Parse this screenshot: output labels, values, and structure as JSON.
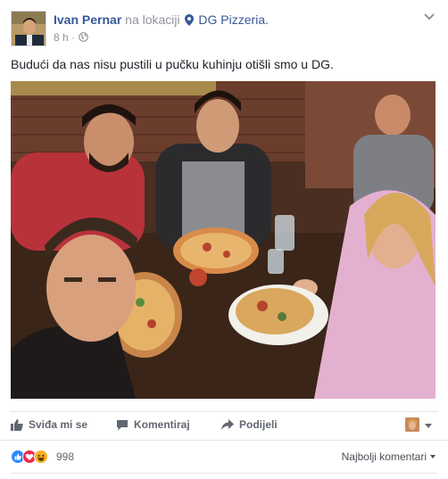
{
  "post": {
    "author": "Ivan Pernar",
    "location_prefix": "na lokaciji",
    "location_name": "DG Pizzeria.",
    "time": "8 h",
    "time_separator": "·",
    "text": "Budući da nas nisu pustili u pučku kuhinju otišli smo u DG."
  },
  "actions": {
    "like": "Sviđa mi se",
    "comment": "Komentiraj",
    "share": "Podijeli"
  },
  "reactions": {
    "icons": [
      "like-reaction-icon",
      "love-reaction-icon",
      "haha-reaction-icon"
    ],
    "count": "998"
  },
  "comments": {
    "sort_label": "Najbolji komentari"
  },
  "colors": {
    "link": "#365899",
    "meta": "#90949c",
    "text": "#1d2129",
    "action": "#616770"
  }
}
